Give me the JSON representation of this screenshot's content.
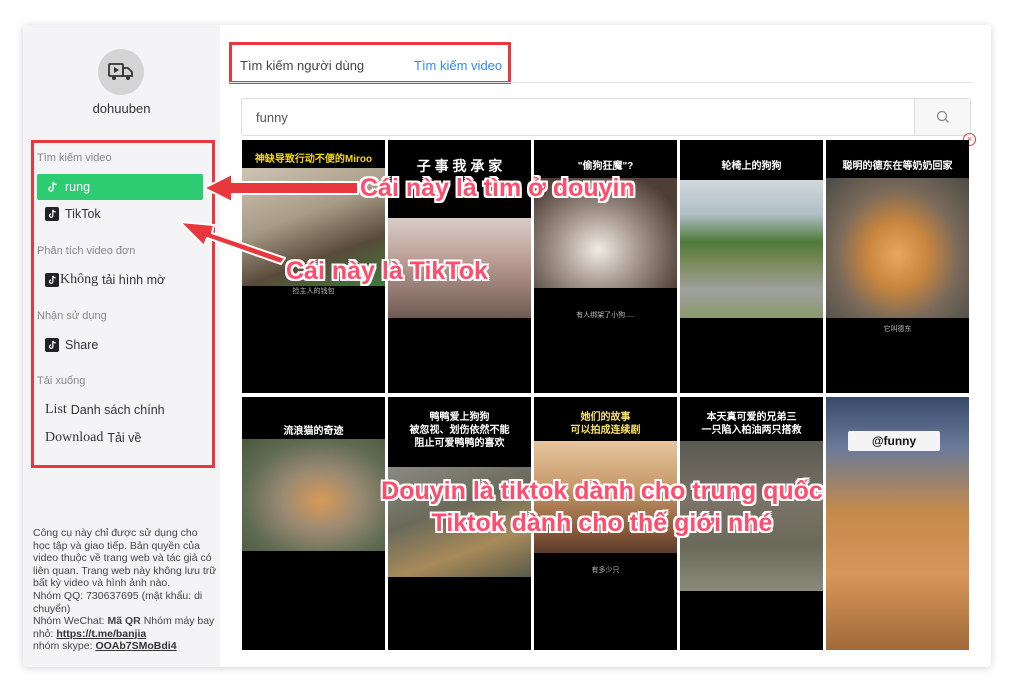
{
  "sidebar": {
    "username": "dohuuben",
    "sections": {
      "search_video": "Tìm kiếm video",
      "analyze_single": "Phân tích video đơn",
      "receive_use": "Nhận sử dụng",
      "download": "Tải xuống"
    },
    "items": {
      "rung": "rung",
      "tiktok": "TikTok",
      "no_watermark_word": "Không",
      "no_watermark_rest": "tải hình mờ",
      "share": "Share",
      "list_word": "List",
      "list_rest": "Danh sách chính",
      "download_word": "Download",
      "download_rest": "Tải về"
    },
    "footer": {
      "line1": "Công cụ này chỉ được sử dụng cho học tập và giao tiếp. Bản quyền của video thuộc về trang web và tác giả có liên quan. Trang web này không lưu trữ bất kỳ video và hình ảnh nào.",
      "qq": "Nhóm QQ: 730637695 (mật khẩu: di chuyển)",
      "wechat_prefix": "Nhóm WeChat:",
      "wechat_bold": "Mã QR",
      "wechat_suffix": "Nhóm máy bay nhỏ:",
      "telegram_link": "https://t.me/banjia",
      "skype_prefix": "nhóm skype:",
      "skype_link": "OOAb7SMoBdi4"
    }
  },
  "tabs": {
    "user_search": "Tìm kiếm người dùng",
    "video_search": "Tìm kiếm video"
  },
  "search": {
    "value": "funny"
  },
  "videos": {
    "v1": {
      "caption": "神缺导致行动不便的Miroo",
      "sub": "捡主人的钱包"
    },
    "v2": {
      "caption": "子 事 我 承 家",
      "sub": ""
    },
    "v3": {
      "caption": "\"偷狗狂魔\"?",
      "sub": "有人绑架了小狗....."
    },
    "v4": {
      "caption": "轮椅上的狗狗",
      "sub": ""
    },
    "v5": {
      "caption": "聪明的德东在等奶奶回家",
      "sub": "它叫德东"
    },
    "v6": {
      "caption": "流浪猫的奇迹",
      "sub": ""
    },
    "v7": {
      "caption": "鸭鸭爱上狗狗\n被忽视、划伤依然不能\n阻止可爱鸭鸭的喜欢",
      "sub": ""
    },
    "v8": {
      "caption": "她们的故事\n可以拍成连续剧",
      "sub": "有多少只"
    },
    "v9": {
      "caption": "本天真可爱的兄弟三\n一只陷入柏油两只搭救",
      "sub": ""
    },
    "v10": {
      "caption": "@funny",
      "sub": ""
    }
  },
  "annotations": {
    "douyin": "Cái này là tìm ở douyin",
    "tiktok": "Cái này là TikTok",
    "explain_line1": "Douyin là tiktok dành cho trung quốc",
    "explain_line2": "Tiktok dành cho thế giới nhé"
  },
  "colors": {
    "accent_green": "#2ecc71",
    "tab_blue": "#2d8cf0",
    "highlight_red": "#e8383d",
    "annotation_pink": "#ff4d6d"
  }
}
